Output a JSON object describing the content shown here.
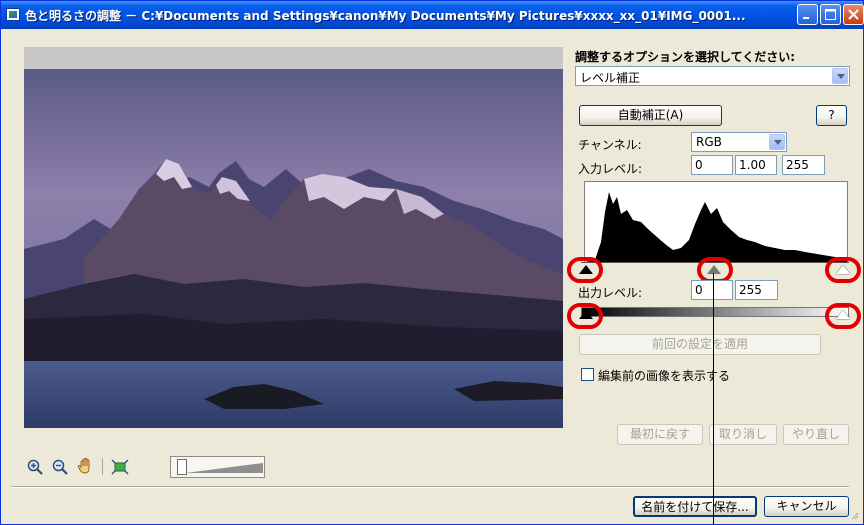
{
  "window": {
    "title": "色と明るさの調整 － C:¥Documents and Settings¥canon¥My Documents¥My Pictures¥xxxx_xx_01¥IMG_0001..."
  },
  "options": {
    "heading": "調整するオプションを選択してください:",
    "selected": "レベル補正"
  },
  "auto_correct_label": "自動補正(A)",
  "help_label": "?",
  "channel": {
    "label": "チャンネル:",
    "value": "RGB"
  },
  "input_levels": {
    "label": "入力レベル:",
    "black": "0",
    "gamma": "1.00",
    "white": "255"
  },
  "output_levels": {
    "label": "出力レベル:",
    "black": "0",
    "white": "255"
  },
  "apply_previous_label": "前回の設定を適用",
  "show_before_label": "編集前の画像を表示する",
  "history": {
    "reset": "最初に戻す",
    "undo": "取り消し",
    "redo": "やり直し"
  },
  "footer": {
    "save_as": "名前を付けて保存...",
    "cancel": "キャンセル"
  },
  "colors": {
    "titlebar": "#0054e3",
    "dialog": "#ece9d8",
    "highlight": "#e00000"
  }
}
